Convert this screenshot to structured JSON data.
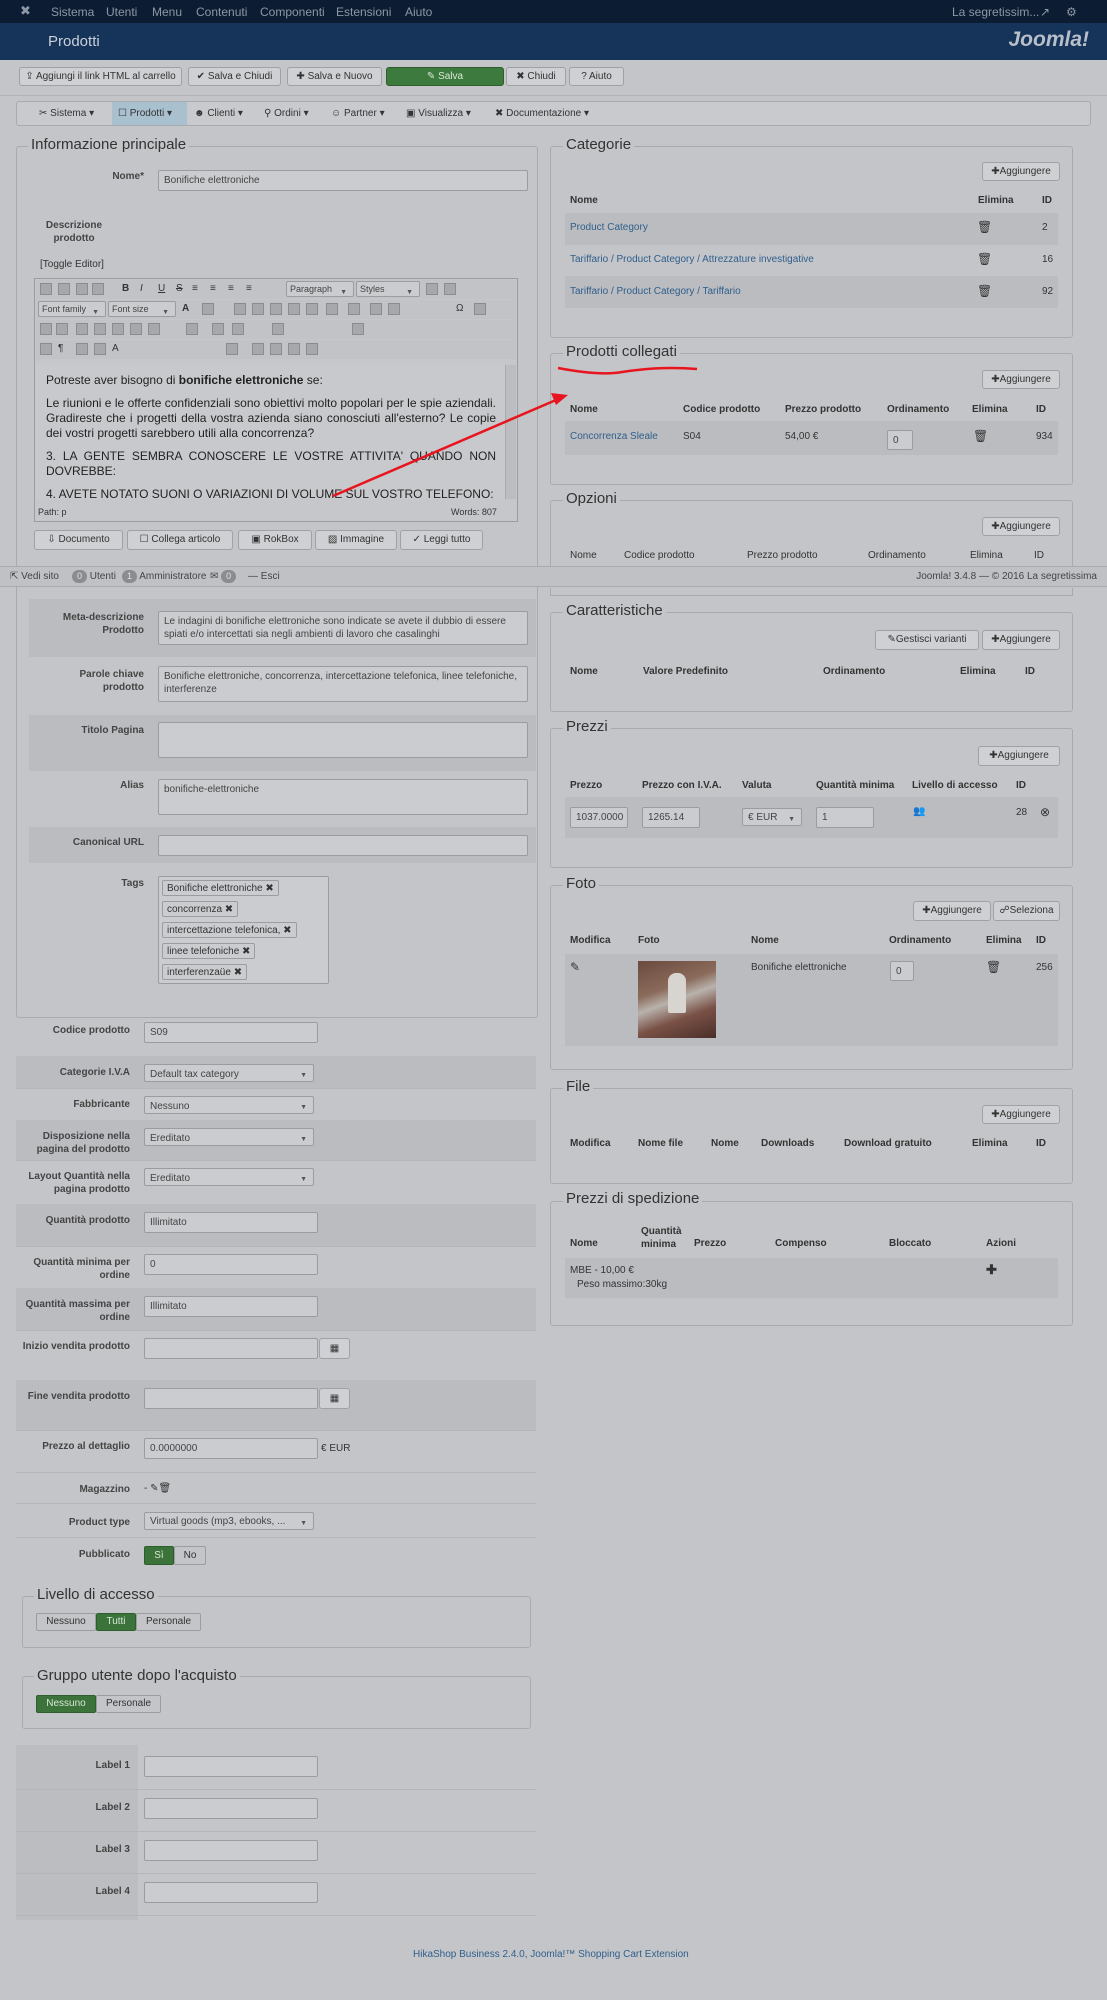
{
  "topbar": {
    "items": [
      "Sistema",
      "Utenti",
      "Menu",
      "Contenuti",
      "Componenti",
      "Estensioni",
      "Aiuto"
    ],
    "user": "La segretissim...",
    "brand": "Joomla!"
  },
  "title": "Prodotti",
  "toolbar": {
    "add_html": "Aggiungi il link HTML al carrello",
    "save_close": "Salva e Chiudi",
    "save_new": "Salva e Nuovo",
    "save": "Salva",
    "close": "Chiudi",
    "help": "Aiuto"
  },
  "menu": [
    "Sistema",
    "Prodotti",
    "Clienti",
    "Ordini",
    "Partner",
    "Visualizza",
    "Documentazione"
  ],
  "main_info": {
    "legend": "Informazione principale",
    "name_label": "Nome*",
    "name_value": "Bonifiche elettroniche",
    "desc_label": "Descrizione prodotto",
    "toggle_editor": "[Toggle Editor]",
    "paragraph": "Paragraph",
    "styles": "Styles",
    "font_family": "Font family",
    "font_size": "Font size",
    "path": "Path: p",
    "words": "Words: 807",
    "content": {
      "p1_pre": "Potreste aver bisogno di ",
      "p1_bold": "bonifiche elettroniche",
      "p1_post": " se:",
      "p2": "Le riunioni e le offerte confidenziali sono obiettivi molto popolari per le spie aziendali. Gradireste che i progetti della vostra azienda siano conosciuti all'esterno? Le copie dei vostri progetti sarebbero utili alla concorrenza?",
      "p3": "3. LA GENTE SEMBRA CONOSCERE LE VOSTRE ATTIVITA' QUANDO NON DOVREBBE:",
      "p4": "4. AVETE NOTATO SUONI O VARIAZIONI DI VOLUME SUL VOSTRO TELEFONO:"
    },
    "editor_buttons": [
      "Documento",
      "Collega articolo",
      "RokBox",
      "Immagine",
      "Leggi tutto"
    ],
    "meta_desc_label": "Meta-descrizione Prodotto",
    "meta_desc_value": "Le indagini di bonifiche elettroniche sono indicate se avete il dubbio di essere spiati e/o intercettati sia negli ambienti di lavoro che casalinghi",
    "keywords_label": "Parole chiave prodotto",
    "keywords_value": "Bonifiche elettroniche, concorrenza, intercettazione telefonica, linee telefoniche, interferenze",
    "page_title_label": "Titolo Pagina",
    "alias_label": "Alias",
    "alias_value": "bonifiche-elettroniche",
    "canonical_label": "Canonical URL",
    "tags_label": "Tags",
    "tags": [
      "Bonifiche elettroniche",
      "concorrenza",
      "intercettazione telefonica,",
      "linee telefoniche",
      "interferenzaüe"
    ]
  },
  "status": {
    "view_site": "Vedi sito",
    "users_count": "0",
    "users": "Utenti",
    "admin_count": "1",
    "admin": "Amministratore",
    "msg_count": "0",
    "logout": "Esci",
    "version": "Joomla! 3.4.8 — © 2016 La segretissima"
  },
  "details": [
    {
      "label": "Codice prodotto",
      "value": "S09",
      "type": "input"
    },
    {
      "label": "Categorie I.V.A",
      "value": "Default tax category",
      "type": "select"
    },
    {
      "label": "Fabbricante",
      "value": "Nessuno",
      "type": "select"
    },
    {
      "label": "Disposizione nella pagina del prodotto",
      "value": "Ereditato",
      "type": "select"
    },
    {
      "label": "Layout Quantità nella pagina prodotto",
      "value": "Ereditato",
      "type": "select"
    },
    {
      "label": "Quantità prodotto",
      "value": "Illimitato",
      "type": "input"
    },
    {
      "label": "Quantità minima per ordine",
      "value": "0",
      "type": "input"
    },
    {
      "label": "Quantità massima per ordine",
      "value": "Illimitato",
      "type": "input"
    },
    {
      "label": "Inizio vendita prodotto",
      "value": "",
      "type": "date"
    },
    {
      "label": "Fine vendita prodotto",
      "value": "",
      "type": "date"
    },
    {
      "label": "Prezzo al dettaglio",
      "value": "0.0000000",
      "type": "price",
      "suffix": "€ EUR"
    }
  ],
  "warehouse_label": "Magazzino",
  "warehouse_value": "-",
  "product_type_label": "Product type",
  "product_type_value": "Virtual goods (mp3, ebooks, ...",
  "published_label": "Pubblicato",
  "yes": "Sì",
  "no": "No",
  "access": {
    "legend": "Livello di accesso",
    "options": [
      "Nessuno",
      "Tutti",
      "Personale"
    ],
    "active": "Tutti"
  },
  "group": {
    "legend": "Gruppo utente dopo l'acquisto",
    "options": [
      "Nessuno",
      "Personale"
    ],
    "active": "Nessuno"
  },
  "labels": [
    "Label 1",
    "Label 2",
    "Label 3",
    "Label 4"
  ],
  "categories": {
    "legend": "Categorie",
    "add": "Aggiungere",
    "headers": [
      "Nome",
      "Elimina",
      "ID"
    ],
    "rows": [
      {
        "path": [
          "Product Category"
        ],
        "id": "2"
      },
      {
        "path": [
          "Tariffario",
          "Product Category",
          "Attrezzature investigative"
        ],
        "id": "16"
      },
      {
        "path": [
          "Tariffario",
          "Product Category",
          "Tariffario"
        ],
        "id": "92"
      }
    ]
  },
  "related": {
    "legend": "Prodotti collegati",
    "add": "Aggiungere",
    "headers": [
      "Nome",
      "Codice prodotto",
      "Prezzo prodotto",
      "Ordinamento",
      "Elimina",
      "ID"
    ],
    "row": {
      "name": "Concorrenza Sleale",
      "code": "S04",
      "price": "54,00 €",
      "order": "0",
      "id": "934"
    }
  },
  "options": {
    "legend": "Opzioni",
    "add": "Aggiungere",
    "headers": [
      "Nome",
      "Codice prodotto",
      "Prezzo prodotto",
      "Ordinamento",
      "Elimina",
      "ID"
    ]
  },
  "characteristics": {
    "legend": "Caratteristiche",
    "manage": "Gestisci varianti",
    "add": "Aggiungere",
    "headers": [
      "Nome",
      "Valore Predefinito",
      "Ordinamento",
      "Elimina",
      "ID"
    ]
  },
  "prices": {
    "legend": "Prezzi",
    "add": "Aggiungere",
    "headers": [
      "Prezzo",
      "Prezzo con I.V.A.",
      "Valuta",
      "Quantità minima",
      "Livello di accesso",
      "ID"
    ],
    "row": {
      "price": "1037.0000",
      "price_vat": "1265.14",
      "currency": "€ EUR",
      "min_qty": "1",
      "id": "28"
    }
  },
  "photos": {
    "legend": "Foto",
    "add": "Aggiungere",
    "select": "Seleziona",
    "headers": [
      "Modifica",
      "Foto",
      "Nome",
      "Ordinamento",
      "Elimina",
      "ID"
    ],
    "row": {
      "name": "Bonifiche elettroniche",
      "order": "0",
      "id": "256"
    }
  },
  "files": {
    "legend": "File",
    "add": "Aggiungere",
    "headers": [
      "Modifica",
      "Nome file",
      "Nome",
      "Downloads",
      "Download gratuito",
      "Elimina",
      "ID"
    ]
  },
  "shipping": {
    "legend": "Prezzi di spedizione",
    "headers": [
      "Nome",
      "Quantità minima",
      "Prezzo",
      "Compenso",
      "Bloccato",
      "Azioni"
    ],
    "row_name": "MBE - 10,00 €",
    "row_weight": "Peso massimo:30kg"
  },
  "footer": "HikaShop Business 2.4.0, Joomla!™ Shopping Cart Extension",
  "colors": {
    "annotation": "#e8141e",
    "save_green": "#3d7a3d",
    "header": "#163459"
  }
}
